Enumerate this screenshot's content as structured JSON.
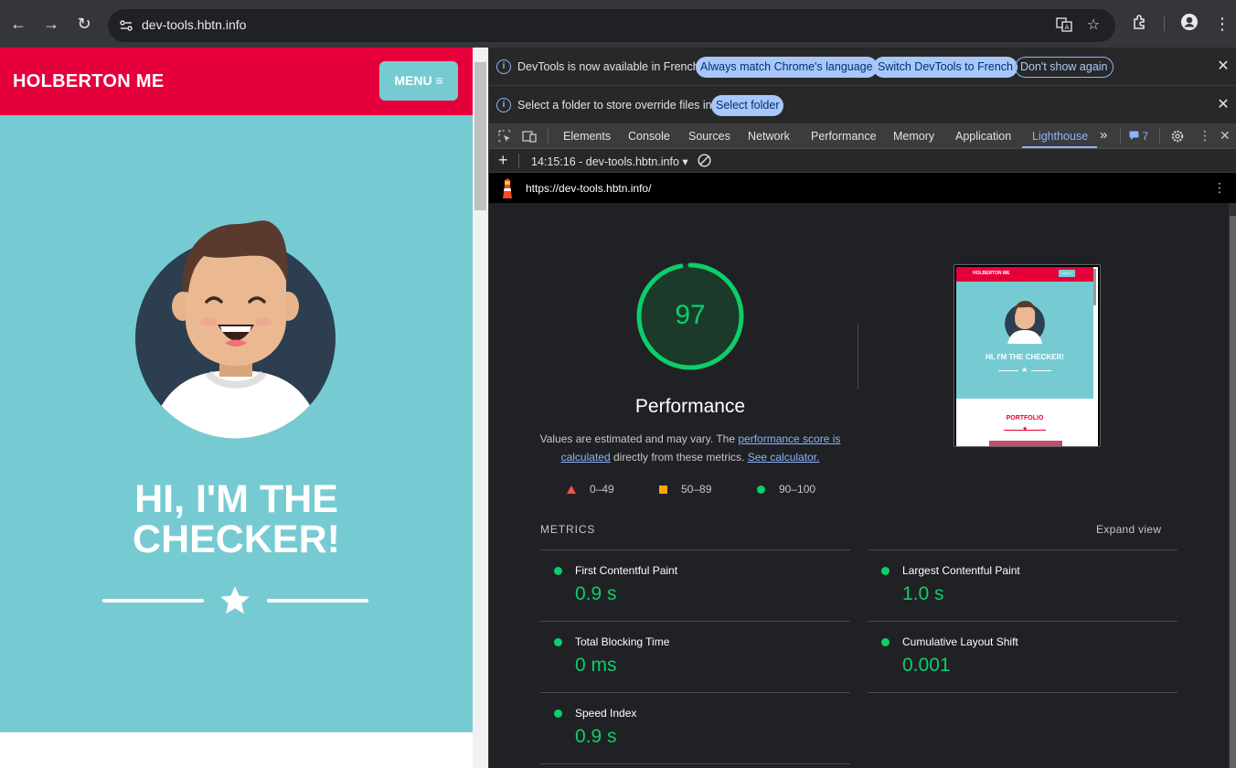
{
  "browser": {
    "url": "dev-tools.hbtn.info"
  },
  "page": {
    "brand": "HOLBERTON ME",
    "menu_label": "MENU ≡",
    "hero_line1": "HI, I'M THE",
    "hero_line2": "CHECKER!"
  },
  "devtools": {
    "infobar1": {
      "text": "DevTools is now available in French!",
      "btn_match": "Always match Chrome's language",
      "btn_switch": "Switch DevTools to French",
      "btn_dismiss": "Don't show again"
    },
    "infobar2": {
      "text": "Select a folder to store override files in.",
      "btn_select": "Select folder"
    },
    "tabs": [
      "Elements",
      "Console",
      "Sources",
      "Network",
      "Performance",
      "Memory",
      "Application",
      "Lighthouse"
    ],
    "active_tab": "Lighthouse",
    "issues_count": "7",
    "report_selector": "14:15:16 - dev-tools.hbtn.info ▾",
    "report_url": "https://dev-tools.hbtn.info/"
  },
  "lighthouse": {
    "score": "97",
    "score_fraction": 0.97,
    "category": "Performance",
    "desc_part1": "Values are estimated and may vary. The ",
    "desc_link1": "performance score is calculated",
    "desc_part2": " directly from these metrics. ",
    "desc_link2": "See calculator.",
    "legend": [
      "0–49",
      "50–89",
      "90–100"
    ],
    "metrics_heading": "METRICS",
    "expand_view": "Expand view",
    "metrics": [
      {
        "name": "First Contentful Paint",
        "value": "0.9 s"
      },
      {
        "name": "Largest Contentful Paint",
        "value": "1.0 s"
      },
      {
        "name": "Total Blocking Time",
        "value": "0 ms"
      },
      {
        "name": "Cumulative Layout Shift",
        "value": "0.001"
      },
      {
        "name": "Speed Index",
        "value": "0.9 s"
      }
    ],
    "thumbnail": {
      "brand": "HOLBERTON ME",
      "menu": "MENU ≡",
      "hero": "HI, I'M THE CHECKER!",
      "section": "PORTFOLIO"
    }
  },
  "colors": {
    "brand_red": "#e6003b",
    "hero_teal": "#76cbd3",
    "score_green": "#0cce6b",
    "devtools_blue": "#8ab4f8"
  }
}
